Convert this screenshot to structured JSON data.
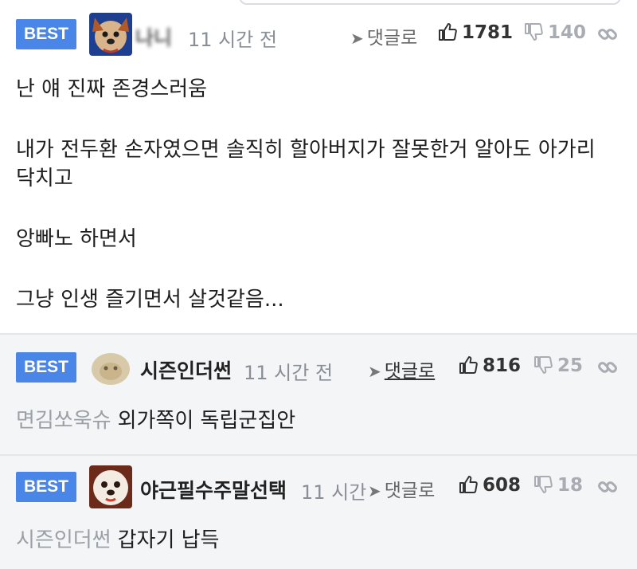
{
  "comments": [
    {
      "badge": "BEST",
      "username": "나니",
      "time": "11 시간 전",
      "reply_label": "댓글로",
      "likes": "1781",
      "dislikes": "140",
      "body_lines": [
        "난 얘 진짜 존경스러움",
        "내가 전두환 손자였으면 솔직히 할아버지가 잘못한거 알아도 아가리",
        "닥치고",
        "앙빠노 하면서",
        "그냥 인생 즐기면서 살것같음..."
      ]
    },
    {
      "badge": "BEST",
      "username": "시즌인더썬",
      "time": "11 시간 전",
      "reply_label": "댓글로",
      "likes": "816",
      "dislikes": "25",
      "mention": "면김쏘욱슈",
      "body": "외가쪽이 독립군집안"
    },
    {
      "badge": "BEST",
      "username": "야근필수주말선택",
      "time": "11 시간",
      "reply_label": "댓글로",
      "likes": "608",
      "dislikes": "18",
      "mention": "시즌인더썬",
      "body": "갑자기 납득"
    }
  ],
  "icons": {
    "reply": "reply-arrow-icon",
    "like": "thumbs-up-icon",
    "dislike": "thumbs-down-icon",
    "link": "link-icon"
  },
  "colors": {
    "badge": "#4a86e8",
    "muted": "#8a8f97",
    "dislike": "#a9adb3",
    "alt_bg": "#f4f5f7"
  }
}
